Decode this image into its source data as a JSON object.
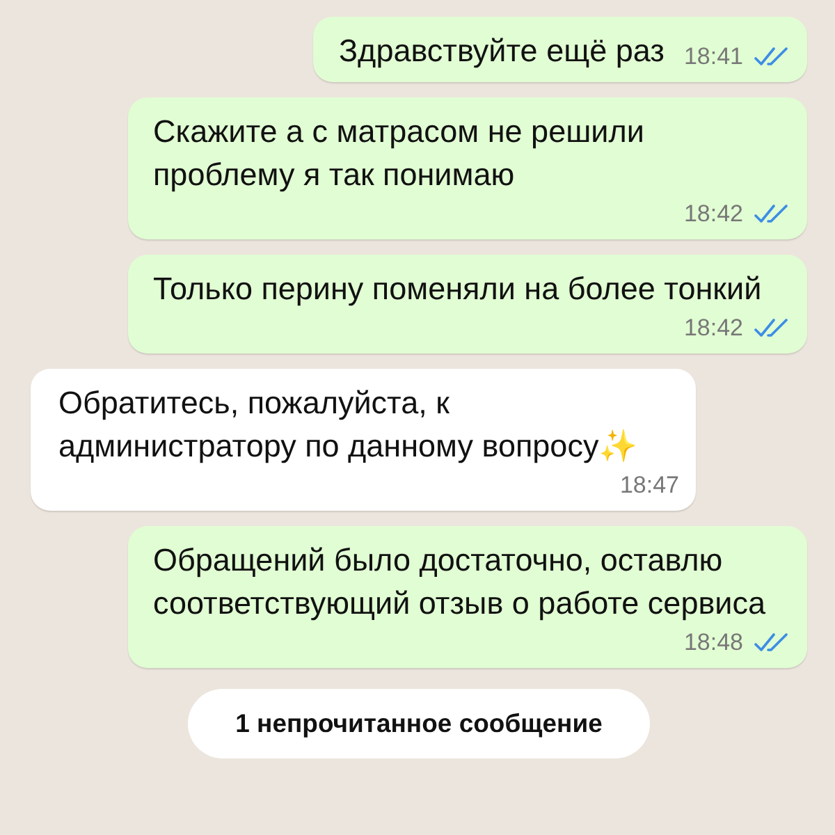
{
  "messages": [
    {
      "kind": "outgoing",
      "text": "Здравствуйте ещё раз",
      "time": "18:41",
      "read": true
    },
    {
      "kind": "outgoing",
      "text": "Скажите а с матрасом не решили проблему я так понимаю",
      "time": "18:42",
      "read": true
    },
    {
      "kind": "outgoing",
      "text": "Только перину поменяли на более тонкий",
      "time": "18:42",
      "read": true
    },
    {
      "kind": "incoming",
      "text": "Обратитесь, пожалуйста, к администратору по данному вопросу✨",
      "time": "18:47"
    },
    {
      "kind": "outgoing",
      "text": "Обращений было достаточно, оставлю соответствующий отзыв о работе сервиса",
      "time": "18:48",
      "read": true
    }
  ],
  "unread_banner": "1 непрочитанное сообщение"
}
